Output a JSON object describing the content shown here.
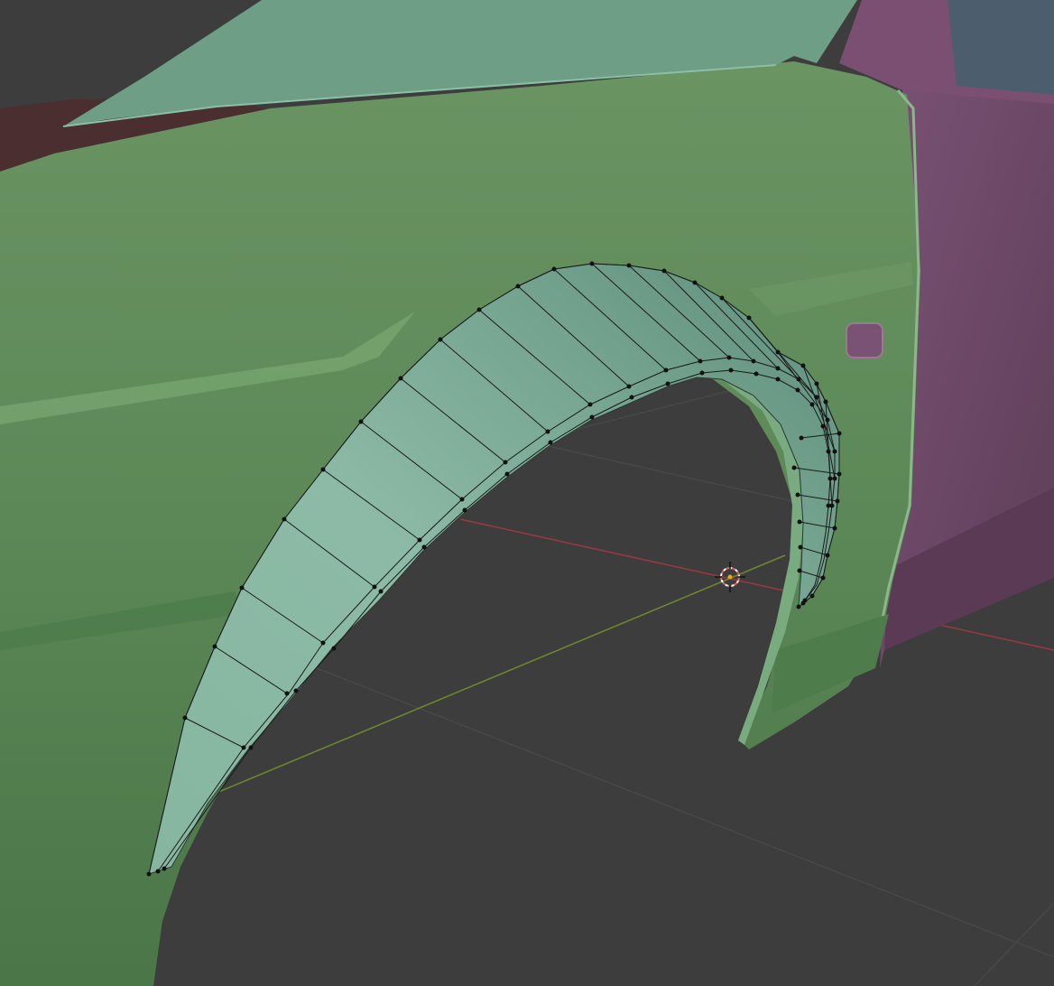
{
  "viewport": {
    "background": "#3d3d3d",
    "grid_color": "#4a4a4a",
    "x_axis_color": "#9a3a40",
    "y_axis_color": "#6e8a2c"
  },
  "materials": {
    "body_green": "#5f8a5a",
    "body_green_dark": "#46704a",
    "hood": "#6e9e86",
    "door_purple": "#6e4a68",
    "window_blue": "#4c5e6e",
    "fender_flare": "#7aab98",
    "flare_inner": "#5f8a78",
    "wire": "#1a1a1a",
    "vertex": "#111111"
  },
  "scene_objects": [
    {
      "name": "hood",
      "type": "mesh",
      "selected": false
    },
    {
      "name": "front-fender",
      "type": "mesh",
      "selected": false
    },
    {
      "name": "door",
      "type": "mesh",
      "selected": false
    },
    {
      "name": "wheel-arch-flare",
      "type": "mesh",
      "selected": true,
      "mode": "edit"
    }
  ],
  "cursor_3d": {
    "label": "3D cursor"
  }
}
